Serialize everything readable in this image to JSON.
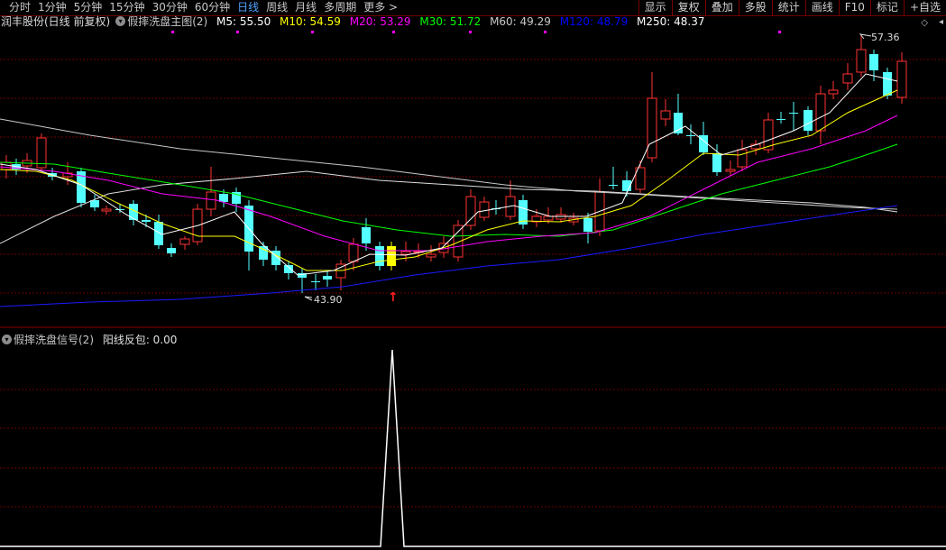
{
  "toolbar": {
    "periods": [
      "分时",
      "1分钟",
      "5分钟",
      "15分钟",
      "30分钟",
      "60分钟",
      "日线",
      "周线",
      "月线",
      "多周期",
      "更多 >"
    ],
    "active_period": "日线",
    "tools": [
      "显示",
      "复权",
      "叠加",
      "多股",
      "统计",
      "画线",
      "F10",
      "标记",
      "+自选"
    ]
  },
  "main_panel": {
    "stock_title": "润丰股份(日线 前复权)",
    "indicator_name": "假摔洗盘主图(2)",
    "ma_labels": [
      {
        "text": "M5: 55.50",
        "color": "#ffffff"
      },
      {
        "text": "M10: 54.59",
        "color": "#ffff00"
      },
      {
        "text": "M20: 53.29",
        "color": "#ff00ff"
      },
      {
        "text": "M30: 51.72",
        "color": "#00ff00"
      },
      {
        "text": "M60: 49.29",
        "color": "#c8c8c8"
      },
      {
        "text": "M120: 48.79",
        "color": "#0000ff"
      },
      {
        "text": "M250: 48.37",
        "color": "#ffffff"
      }
    ],
    "high_label": "57.36",
    "low_label": "43.90",
    "signal_arrow": "↑"
  },
  "sub_panel": {
    "indicator_name": "假摔洗盘信号(2)",
    "value_label": "阳线反包: 0.00"
  },
  "colors": {
    "up": "#ff3232",
    "down": "#54ffff",
    "signal": "#ffff00",
    "grid": "#6e0000",
    "ma5": "#ffffff",
    "ma10": "#ffff00",
    "ma20": "#ff00ff",
    "ma30": "#00ff00",
    "ma60": "#c8c8c8",
    "ma120": "#1a1aff",
    "ma250": "#dddddd"
  }
}
